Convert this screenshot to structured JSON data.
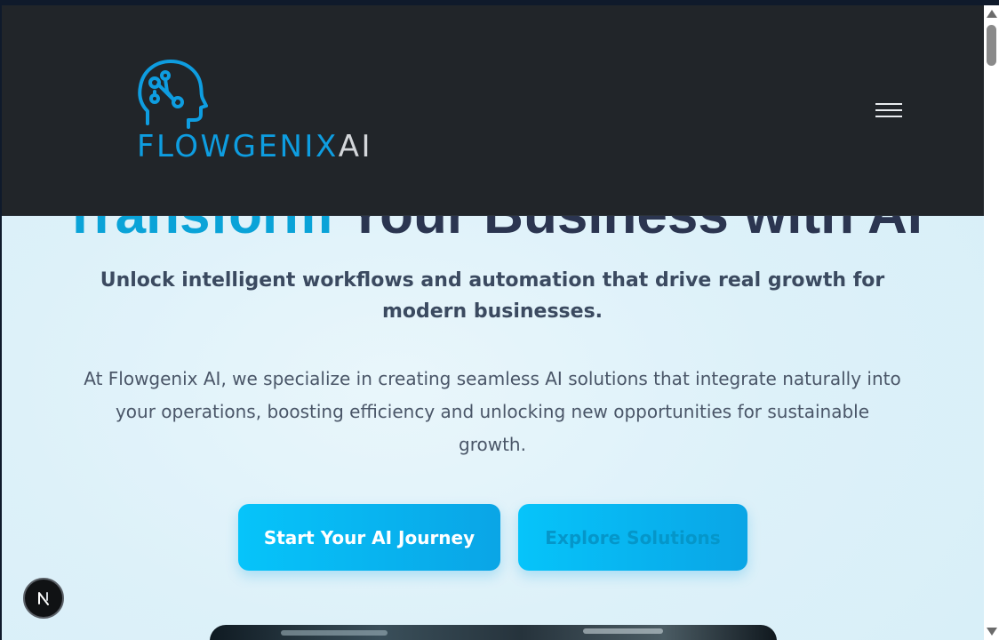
{
  "header": {
    "logo": {
      "icon": "brain-head-icon",
      "brand_main": "FLOWGENIX",
      "brand_suffix": "AI"
    },
    "menu_icon": "hamburger-menu-icon"
  },
  "hero": {
    "title_accent": "Transform",
    "title_rest": " Your Business with AI",
    "tagline": "Unlock intelligent workflows and automation that drive real growth for modern businesses.",
    "description": "At Flowgenix AI, we specialize in creating seamless AI solutions that integrate naturally into your operations, boosting efficiency and unlocking new opportunities for sustainable growth.",
    "primary_button": "Start Your AI Journey",
    "secondary_button": "Explore Solutions"
  },
  "dev_badge": {
    "letter": "N"
  },
  "colors": {
    "accent": "#0aa3d8",
    "header_bg": "#212529",
    "button_gradient_start": "#06c4fa",
    "button_gradient_end": "#0aa5e6"
  }
}
